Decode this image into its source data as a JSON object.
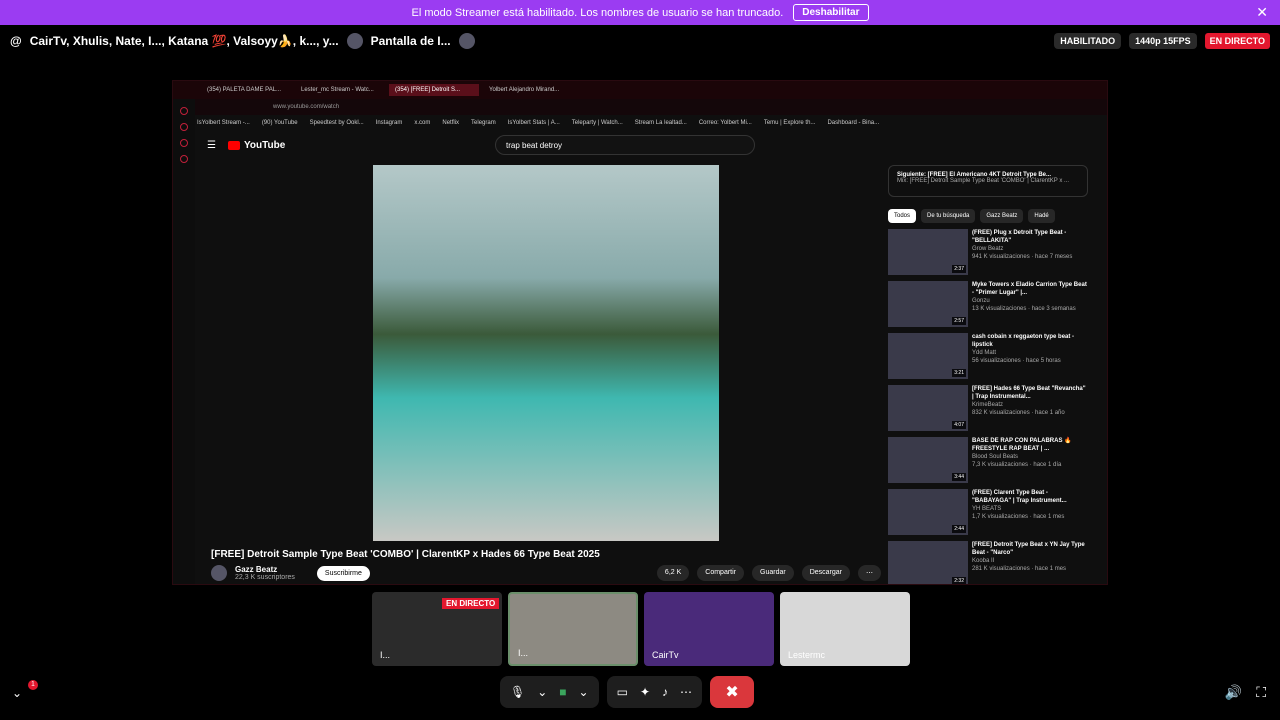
{
  "banner": {
    "text": "El modo Streamer está habilitado. Los nombres de usuario se han truncado.",
    "button": "Deshabilitar"
  },
  "callbar": {
    "participants": "CairTv, Xhulis, Nate, I..., Katana 💯, Valsoyy🍌, k..., y...",
    "screen_label": "Pantalla de I...",
    "status": "HABILITADO",
    "quality": "1440p 15FPS",
    "live": "EN DIRECTO"
  },
  "browser": {
    "tabs": [
      "(354) PALETA DAME PAL...",
      "Lester_mc Stream - Watc...",
      "(354) [FREE] Detroit S...",
      "Yolbert Alejandro Mirand..."
    ],
    "address": "www.youtube.com/watch",
    "bookmarks": [
      "IsYolbert Stream -...",
      "(90) YouTube",
      "Speedtest by Ookl...",
      "Instagram",
      "x.com",
      "Netflix",
      "Telegram",
      "IsYolbert Stats | A...",
      "Teleparty | Watch...",
      "Stream La lealtad...",
      "Correo: Yolbert Mi...",
      "Temu | Explore th...",
      "Dashboard - Bina..."
    ]
  },
  "youtube": {
    "logo": "YouTube",
    "search": "trap beat detroy",
    "video_title": "[FREE] Detroit Sample Type Beat 'COMBO' | ClarentKP x Hades 66 Type Beat 2025",
    "channel": "Gazz Beatz",
    "subscribers": "22,3 K suscriptores",
    "subscribe": "Suscribirme",
    "likes": "6,2 K",
    "share": "Compartir",
    "save": "Guardar",
    "download": "Descargar",
    "next_label": "Siguiente: [FREE] El Americano 4KT Detroit Type Be...",
    "next_mix": "Mix: [FREE] Detroit Sample Type Beat 'COMBO' | ClarentKP x ...",
    "chips": [
      "Todos",
      "De tu búsqueda",
      "Gazz Beatz",
      "Hadé"
    ],
    "recs": [
      {
        "title": "(FREE) Plug x Detroit Type Beat - \"BELLAKITA\"",
        "channel": "Grow Beatz",
        "meta": "941 K visualizaciones · hace 7 meses",
        "dur": "2:37"
      },
      {
        "title": "Myke Towers x Eladio Carrion Type Beat - \"Primer Lugar\" |...",
        "channel": "Gonzu",
        "meta": "13 K visualizaciones · hace 3 semanas",
        "dur": "2:57"
      },
      {
        "title": "cash cobain x reggaeton type beat - lipstick",
        "channel": "Ydd Matt",
        "meta": "56 visualizaciones · hace 5 horas",
        "dur": "3:21"
      },
      {
        "title": "[FREE] Hades 66 Type Beat \"Revancha\" | Trap Instrumental...",
        "channel": "KrimeBeatz",
        "meta": "832 K visualizaciones · hace 1 año",
        "dur": "4:07"
      },
      {
        "title": "BASE DE RAP CON PALABRAS 🔥FREESTYLE RAP BEAT | ...",
        "channel": "Blood Soul Beats",
        "meta": "7,3 K visualizaciones · hace 1 día",
        "dur": "3:44"
      },
      {
        "title": "(FREE) Clarent Type Beat - \"BABAYAGA\" | Trap Instrument...",
        "channel": "YH BEATS",
        "meta": "1,7 K visualizaciones · hace 1 mes",
        "dur": "2:44"
      },
      {
        "title": "[FREE] Detroit Type Beat x YN Jay Type Beat - \"Narco\"",
        "channel": "Kooba II",
        "meta": "281 K visualizaciones · hace 1 mes",
        "dur": "2:32"
      }
    ]
  },
  "tiles": [
    {
      "label": "I...",
      "live": "EN DIRECTO"
    },
    {
      "label": "I...",
      "live": ""
    },
    {
      "label": "CairTv",
      "live": ""
    },
    {
      "label": "Lestermc",
      "live": ""
    }
  ],
  "notifications": "1"
}
